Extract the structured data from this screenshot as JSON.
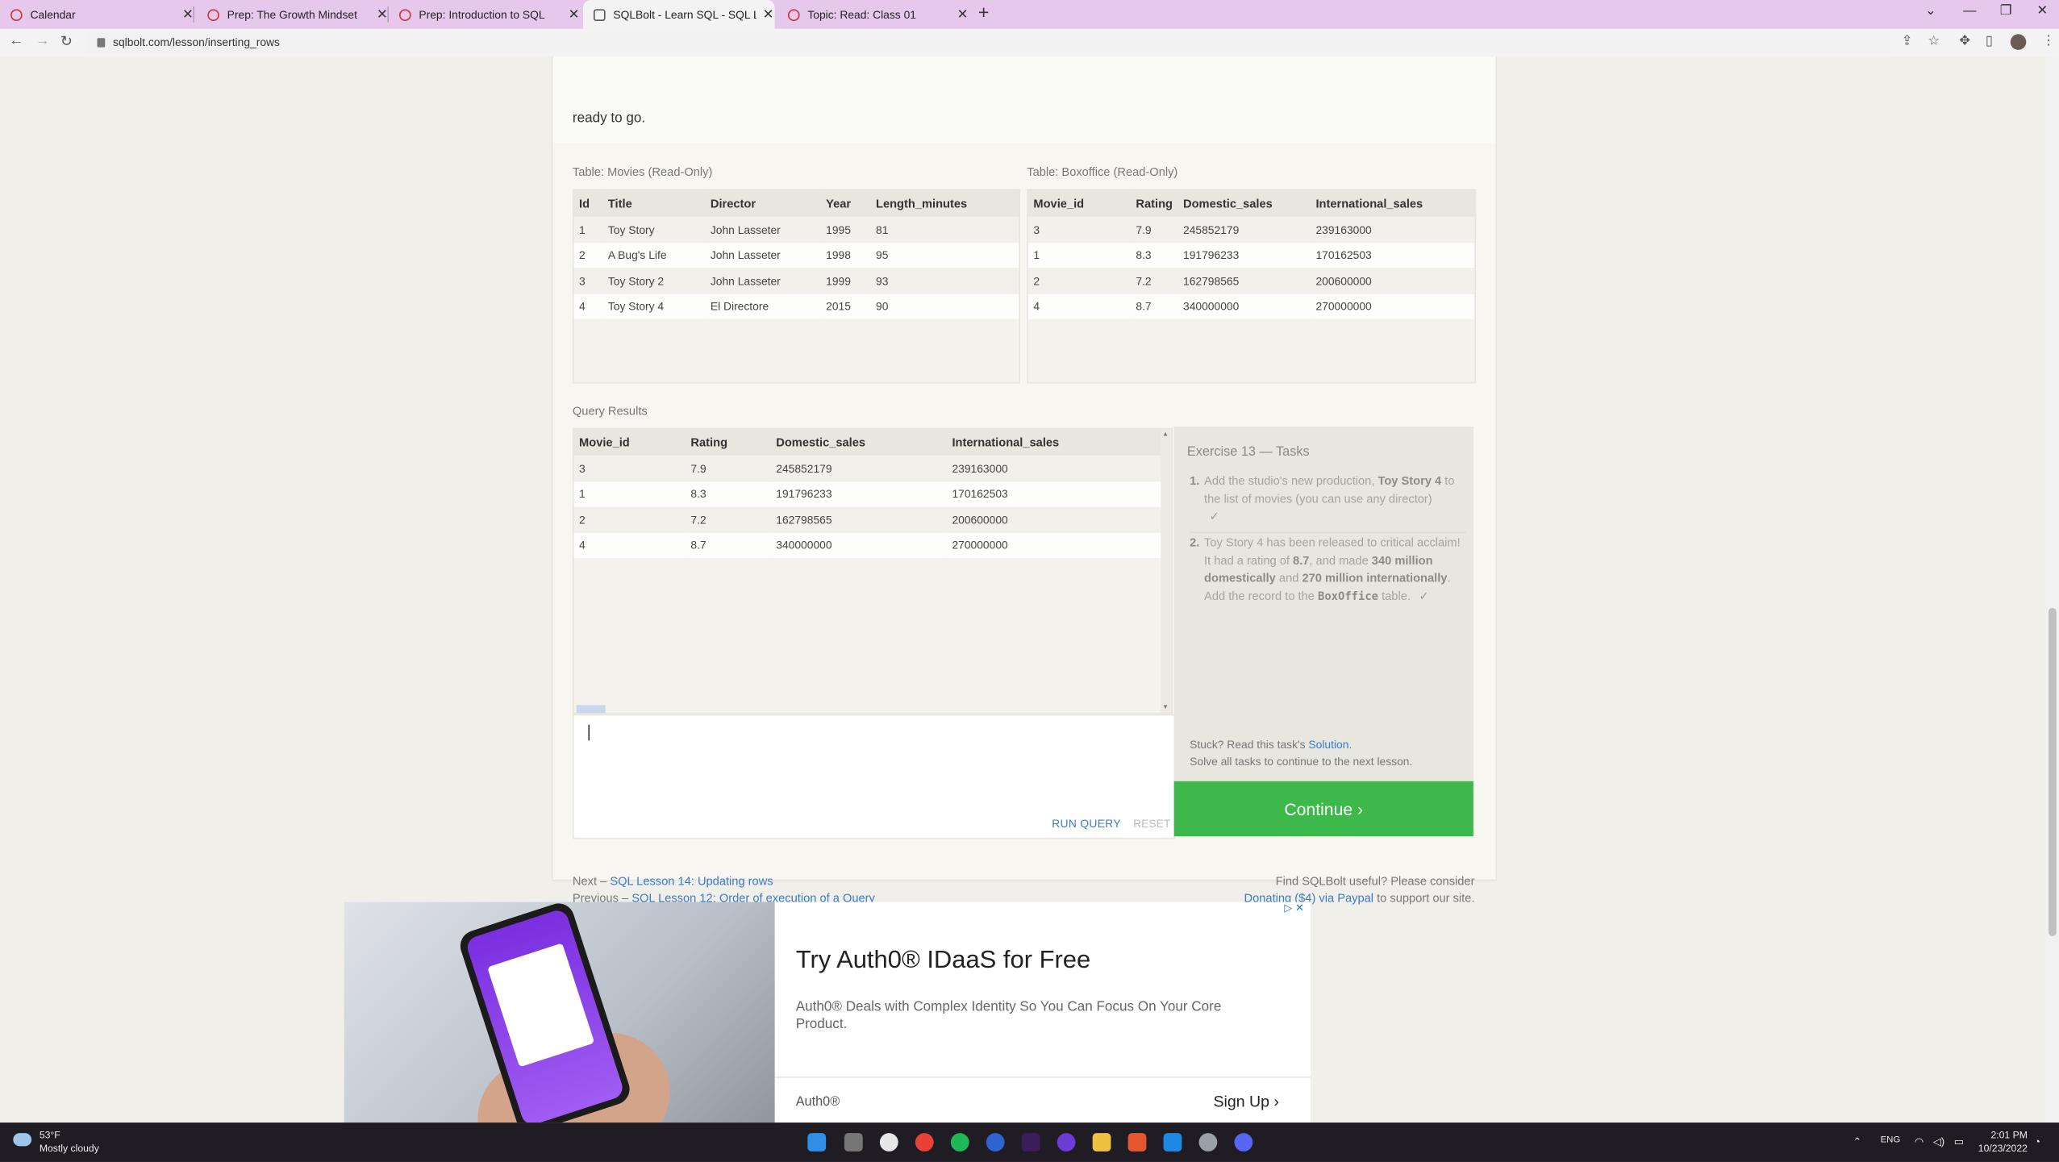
{
  "browser": {
    "tabs": [
      {
        "label": "Calendar",
        "active": false
      },
      {
        "label": "Prep: The Growth Mindset",
        "active": false
      },
      {
        "label": "Prep: Introduction to SQL",
        "active": false
      },
      {
        "label": "SQLBolt - Learn SQL - SQL Lesson",
        "active": true
      },
      {
        "label": "Topic: Read: Class 01",
        "active": false
      }
    ],
    "new_tab": "+",
    "url": "sqlbolt.com/lesson/inserting_rows"
  },
  "lesson": {
    "intro_tail": "ready to go.",
    "movies_table": {
      "caption": "Table: Movies (Read-Only)",
      "headers": [
        "Id",
        "Title",
        "Director",
        "Year",
        "Length_minutes"
      ],
      "rows": [
        [
          "1",
          "Toy Story",
          "John Lasseter",
          "1995",
          "81"
        ],
        [
          "2",
          "A Bug's Life",
          "John Lasseter",
          "1998",
          "95"
        ],
        [
          "3",
          "Toy Story 2",
          "John Lasseter",
          "1999",
          "93"
        ],
        [
          "4",
          "Toy Story 4",
          "El Directore",
          "2015",
          "90"
        ]
      ]
    },
    "boxoffice_table": {
      "caption": "Table: Boxoffice (Read-Only)",
      "headers": [
        "Movie_id",
        "Rating",
        "Domestic_sales",
        "International_sales"
      ],
      "rows": [
        [
          "3",
          "7.9",
          "245852179",
          "239163000"
        ],
        [
          "1",
          "8.3",
          "191796233",
          "170162503"
        ],
        [
          "2",
          "7.2",
          "162798565",
          "200600000"
        ],
        [
          "4",
          "8.7",
          "340000000",
          "270000000"
        ]
      ]
    },
    "query_results": {
      "caption": "Query Results",
      "headers": [
        "Movie_id",
        "Rating",
        "Domestic_sales",
        "International_sales"
      ],
      "rows": [
        [
          "3",
          "7.9",
          "245852179",
          "239163000"
        ],
        [
          "1",
          "8.3",
          "191796233",
          "170162503"
        ],
        [
          "2",
          "7.2",
          "162798565",
          "200600000"
        ],
        [
          "4",
          "8.7",
          "340000000",
          "270000000"
        ]
      ]
    },
    "editor": {
      "value": "",
      "run_label": "RUN QUERY",
      "reset_label": "RESET"
    },
    "exercise": {
      "title": "Exercise 13 — Tasks",
      "task1_num": "1.",
      "task1_a": "Add the studio's new production, ",
      "task1_b": "Toy Story 4",
      "task1_c": " to the list of movies (you can use any director)",
      "task2_num": "2.",
      "task2_a": "Toy Story 4 has been released to critical acclaim! It had a rating of ",
      "task2_b": "8.7",
      "task2_c": ", and made ",
      "task2_d": "340 million domestically",
      "task2_e": " and ",
      "task2_f": "270 million internationally",
      "task2_g": ". Add the record to the ",
      "task2_code": "BoxOffice",
      "task2_h": " table.",
      "check": "✓",
      "stuck_prefix": "Stuck? Read this task's ",
      "stuck_link": "Solution",
      "stuck_suffix": ".",
      "solve_all": "Solve all tasks to continue to the next lesson.",
      "continue_label": "Continue ›"
    },
    "footer": {
      "next_prefix": "Next – ",
      "next_link": "SQL Lesson 14: Updating rows",
      "prev_prefix": "Previous – ",
      "prev_link": "SQL Lesson 12: Order of execution of a Query",
      "useful": "Find SQLBolt useful? Please consider",
      "donate_link": "Donating ($4) via Paypal",
      "donate_suffix": " to support our site."
    }
  },
  "ad": {
    "title": "Try Auth0® IDaaS for Free",
    "description": "Auth0® Deals with Complex Identity So You Can Focus On Your Core Product.",
    "brand": "Auth0®",
    "cta": "Sign Up"
  },
  "taskbar": {
    "temperature": "53°F",
    "weather": "Mostly cloudy",
    "language": "ENG",
    "time": "2:01 PM",
    "date": "10/23/2022"
  }
}
